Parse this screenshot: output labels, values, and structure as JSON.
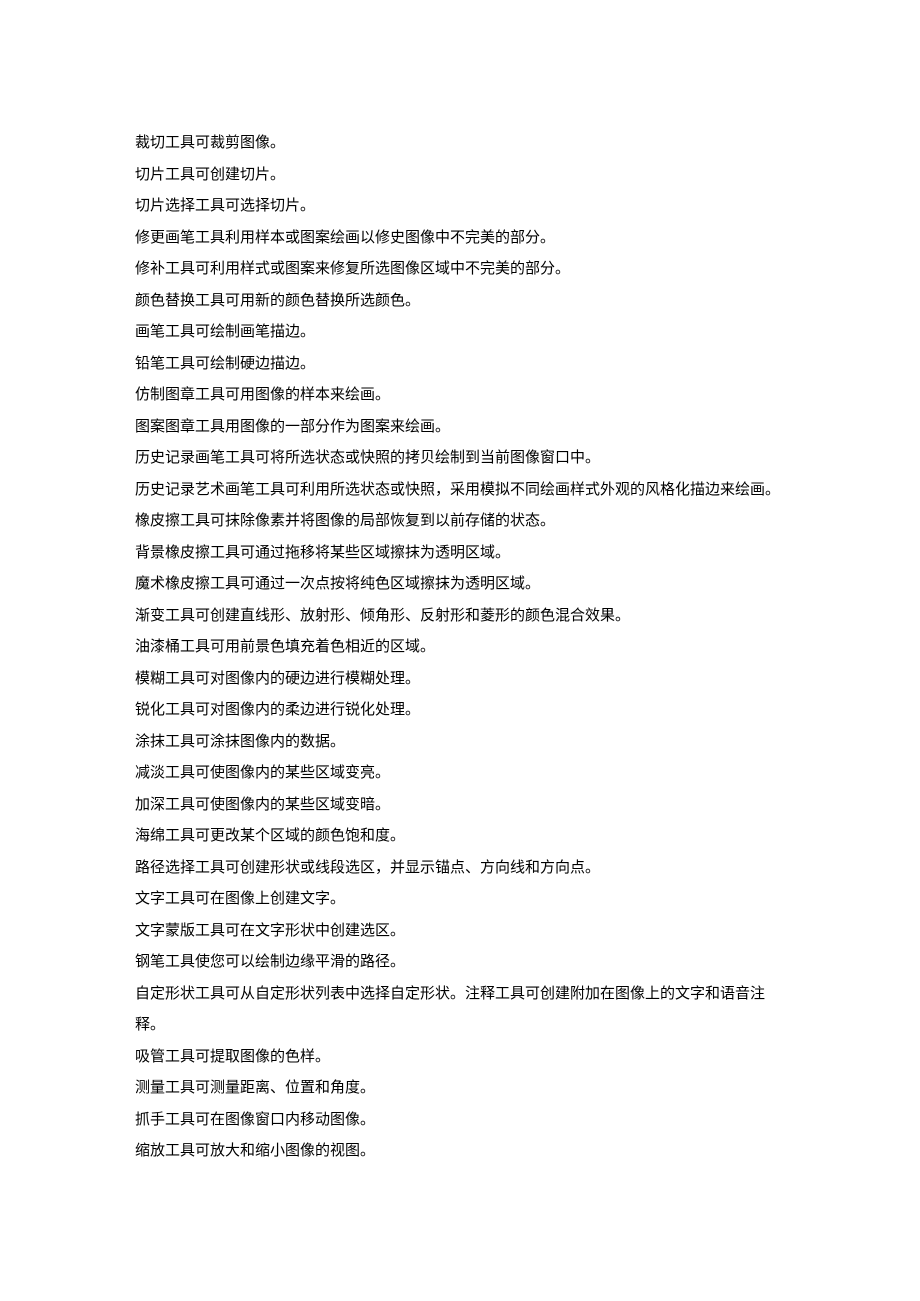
{
  "lines": [
    "裁切工具可裁剪图像。",
    "切片工具可创建切片。",
    "切片选择工具可选择切片。",
    "修更画笔工具利用样本或图案绘画以修史图像中不完美的部分。",
    "修补工具可利用样式或图案来修复所选图像区域中不完美的部分。",
    "颜色替换工具可用新的颜色替换所选颜色。",
    "画笔工具可绘制画笔描边。",
    "铅笔工具可绘制硬边描边。",
    "仿制图章工具可用图像的样本来绘画。",
    "图案图章工具用图像的一部分作为图案来绘画。",
    "历史记录画笔工具可将所选状态或快照的拷贝绘制到当前图像窗口中。",
    "历史记录艺术画笔工具可利用所选状态或快照，采用模拟不同绘画样式外观的风格化描边来绘画。",
    "橡皮擦工具可抹除像素并将图像的局部恢复到以前存储的状态。",
    "背景橡皮擦工具可通过拖移将某些区域擦抹为透明区域。",
    "魔术橡皮擦工具可通过一次点按将纯色区域擦抹为透明区域。",
    "渐变工具可创建直线形、放射形、倾角形、反射形和菱形的颜色混合效果。",
    "油漆桶工具可用前景色填充着色相近的区域。",
    "模糊工具可对图像内的硬边进行模糊处理。",
    "锐化工具可对图像内的柔边进行锐化处理。",
    "涂抹工具可涂抹图像内的数据。",
    "减淡工具可使图像内的某些区域变亮。",
    "加深工具可使图像内的某些区域变暗。",
    "海绵工具可更改某个区域的颜色饱和度。",
    "路径选择工具可创建形状或线段选区，并显示锚点、方向线和方向点。",
    "文字工具可在图像上创建文字。",
    "文字蒙版工具可在文字形状中创建选区。",
    "钢笔工具使您可以绘制边缘平滑的路径。",
    "自定形状工具可从自定形状列表中选择自定形状。注释工具可创建附加在图像上的文字和语音注释。",
    "吸管工具可提取图像的色样。",
    "测量工具可测量距离、位置和角度。",
    "抓手工具可在图像窗口内移动图像。",
    "缩放工具可放大和缩小图像的视图。"
  ]
}
